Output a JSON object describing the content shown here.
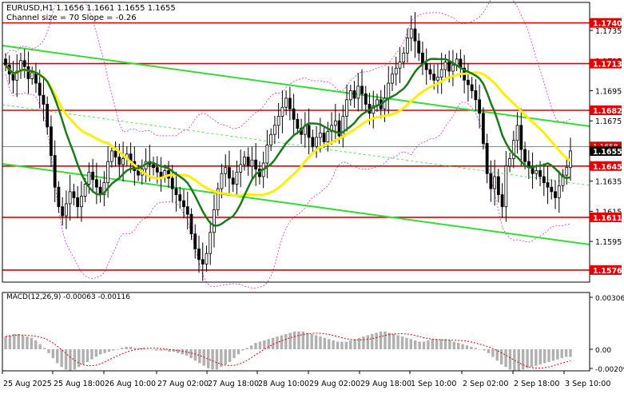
{
  "header": {
    "symbol_line": "EURUSD,H1  1.1656 1.1661 1.1655 1.1655",
    "channel_line": "Channel size = 70 Slope = -0.26"
  },
  "macd_label": "MACD(12,26,9) -0.00063 -0.00116",
  "colors": {
    "candle": "#000000",
    "level": "#e00000",
    "channel": "#33dd33",
    "ma_fast": "#1a7a1a",
    "ma_slow": "#ffee00",
    "bands": "#cc33cc",
    "macd_hist": "#b0b0b0",
    "macd_signal": "#e00000",
    "current_price_bg": "#000000"
  },
  "chart_data": {
    "type": "candlestick",
    "price_axis": {
      "min": 1.1568,
      "max": 1.1752,
      "ticks": [
        "1.1735",
        "1.1715",
        "1.1695",
        "1.1675",
        "1.1655",
        "1.1635",
        "1.1615",
        "1.1595"
      ]
    },
    "levels": [
      {
        "label": "1.1740",
        "value": 1.174
      },
      {
        "label": "1.1713",
        "value": 1.1713
      },
      {
        "label": "1.1682",
        "value": 1.1682
      },
      {
        "label": "1.1645",
        "value": 1.1645
      },
      {
        "label": "1.1611",
        "value": 1.1611
      },
      {
        "label": "1.1576",
        "value": 1.1576
      }
    ],
    "current_price": {
      "label": "1.1655",
      "value": 1.1655
    },
    "upper_tag": {
      "label": "1.1658",
      "value": 1.1658
    },
    "time_labels": [
      "25 Aug 2025",
      "25 Aug 18:00",
      "26 Aug 10:00",
      "27 Aug 02:00",
      "27 Aug 18:00",
      "28 Aug 10:00",
      "29 Aug 02:00",
      "29 Aug 18:00",
      "1 Sep 10:00",
      "2 Sep 02:00",
      "2 Sep 18:00",
      "3 Sep 10:00"
    ],
    "closes": [
      1.1712,
      1.1706,
      1.1702,
      1.1708,
      1.1715,
      1.1711,
      1.1703,
      1.1707,
      1.17,
      1.1692,
      1.1686,
      1.1671,
      1.1652,
      1.1631,
      1.1618,
      1.1612,
      1.162,
      1.1628,
      1.1624,
      1.1618,
      1.1625,
      1.1633,
      1.1641,
      1.1636,
      1.1631,
      1.1626,
      1.1634,
      1.1648,
      1.1655,
      1.1651,
      1.1646,
      1.165,
      1.1653,
      1.1648,
      1.1642,
      1.1639,
      1.1643,
      1.1648,
      1.1646,
      1.1644,
      1.1641,
      1.1638,
      1.1642,
      1.1637,
      1.163,
      1.1626,
      1.1622,
      1.1618,
      1.1613,
      1.16,
      1.159,
      1.1583,
      1.158,
      1.1587,
      1.1601,
      1.1616,
      1.163,
      1.164,
      1.1644,
      1.1637,
      1.1633,
      1.1641,
      1.1646,
      1.1651,
      1.1645,
      1.1649,
      1.1643,
      1.1638,
      1.1647,
      1.1659,
      1.1666,
      1.1672,
      1.1678,
      1.1684,
      1.169,
      1.1683,
      1.1676,
      1.167,
      1.1666,
      1.1672,
      1.1664,
      1.1658,
      1.1664,
      1.1667,
      1.1661,
      1.1668,
      1.1672,
      1.1675,
      1.1665,
      1.1678,
      1.1689,
      1.1695,
      1.169,
      1.1698,
      1.1693,
      1.1686,
      1.168,
      1.1685,
      1.1689,
      1.1683,
      1.169,
      1.17,
      1.1706,
      1.171,
      1.1714,
      1.172,
      1.173,
      1.1736,
      1.1728,
      1.172,
      1.1713,
      1.1709,
      1.1706,
      1.1702,
      1.1704,
      1.1709,
      1.1714,
      1.1708,
      1.1712,
      1.1716,
      1.171,
      1.1702,
      1.1699,
      1.1695,
      1.1689,
      1.168,
      1.166,
      1.164,
      1.163,
      1.1638,
      1.1626,
      1.1618,
      1.1645,
      1.165,
      1.1662,
      1.1672,
      1.1656,
      1.1648,
      1.1644,
      1.164,
      1.1642,
      1.1638,
      1.1634,
      1.1631,
      1.1628,
      1.1624,
      1.1632,
      1.1639,
      1.1644,
      1.1655
    ],
    "macd": {
      "axis_ticks": [
        "0.00306",
        "0.00",
        "-0.00209"
      ],
      "histogram": [
        0.001,
        0.0011,
        0.0012,
        0.0012,
        0.0011,
        0.001,
        0.0009,
        0.0007,
        0.0004,
        0.0001,
        -0.0003,
        -0.0007,
        -0.0011,
        -0.0014,
        -0.0016,
        -0.0017,
        -0.0016,
        -0.0014,
        -0.0012,
        -0.001,
        -0.0008,
        -0.0006,
        -0.0004,
        -0.0003,
        -0.0002,
        -0.0001,
        0.0,
        0.0001,
        0.0002,
        0.0002,
        0.0001,
        0.0001,
        0.0001,
        0.0,
        0.0,
        -0.0001,
        -0.0001,
        -0.0001,
        -0.0002,
        -0.0002,
        -0.0003,
        -0.0004,
        -0.0005,
        -0.0007,
        -0.0009,
        -0.0011,
        -0.0013,
        -0.0015,
        -0.0016,
        -0.0016,
        -0.0014,
        -0.0012,
        -0.001,
        -0.0007,
        -0.0004,
        -0.0001,
        0.0001,
        0.0003,
        0.0005,
        0.0006,
        0.0007,
        0.0008,
        0.0009,
        0.001,
        0.0011,
        0.0012,
        0.0013,
        0.0014,
        0.0014,
        0.0014,
        0.0013,
        0.0012,
        0.0011,
        0.001,
        0.0009,
        0.0008,
        0.0007,
        0.0006,
        0.0006,
        0.0006,
        0.0007,
        0.0008,
        0.0009,
        0.001,
        0.0011,
        0.0012,
        0.0013,
        0.0014,
        0.0014,
        0.0013,
        0.0012,
        0.0011,
        0.001,
        0.0009,
        0.0008,
        0.0007,
        0.0006,
        0.0006,
        0.0007,
        0.0008,
        0.0008,
        0.0008,
        0.0008,
        0.0007,
        0.0006,
        0.0005,
        0.0004,
        0.0003,
        0.0002,
        0.0001,
        0.0,
        -0.0001,
        -0.0003,
        -0.0006,
        -0.0009,
        -0.0012,
        -0.0014,
        -0.0016,
        -0.0017,
        -0.0017,
        -0.0016,
        -0.0015,
        -0.0014,
        -0.0013,
        -0.0012,
        -0.0011,
        -0.001,
        -0.0009,
        -0.0008,
        -0.0007,
        -0.0006,
        -0.0006
      ]
    }
  }
}
